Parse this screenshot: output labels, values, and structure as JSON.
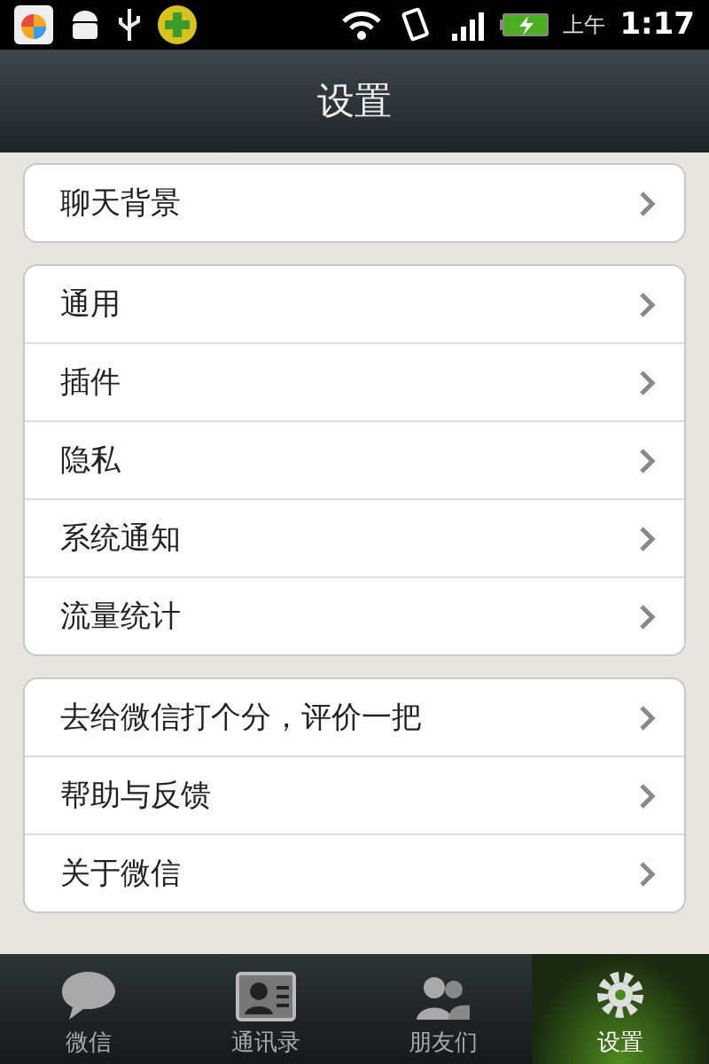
{
  "status_bar": {
    "period": "上午",
    "time": "1:17"
  },
  "header": {
    "title": "设置"
  },
  "groups": [
    {
      "items": [
        {
          "label": "聊天背景"
        }
      ]
    },
    {
      "items": [
        {
          "label": "通用"
        },
        {
          "label": "插件"
        },
        {
          "label": "隐私"
        },
        {
          "label": "系统通知"
        },
        {
          "label": "流量统计"
        }
      ]
    },
    {
      "items": [
        {
          "label": "去给微信打个分，评价一把"
        },
        {
          "label": "帮助与反馈"
        },
        {
          "label": "关于微信"
        }
      ]
    }
  ],
  "tabs": [
    {
      "label": "微信",
      "kind": "chat",
      "selected": false
    },
    {
      "label": "通讯录",
      "kind": "contacts",
      "selected": false
    },
    {
      "label": "朋友们",
      "kind": "friends",
      "selected": false
    },
    {
      "label": "设置",
      "kind": "settings",
      "selected": true
    }
  ]
}
